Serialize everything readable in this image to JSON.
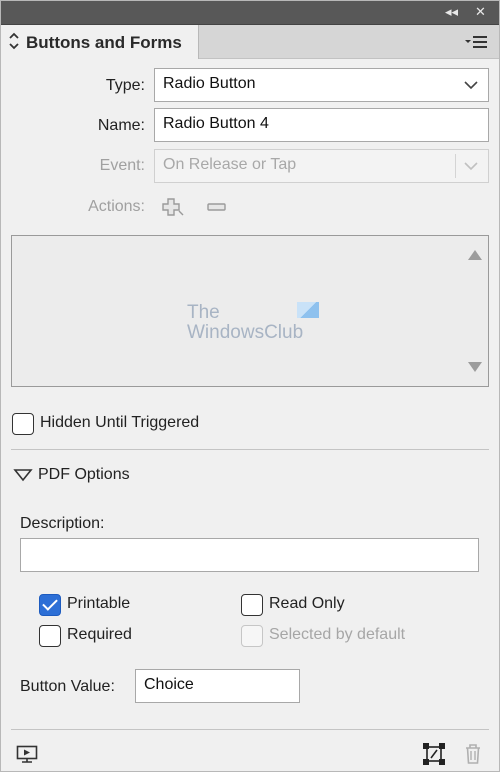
{
  "panel": {
    "title": "Buttons and Forms",
    "collapse_glyph": "◂◂",
    "close_glyph": "✕"
  },
  "form": {
    "type_label": "Type:",
    "type_value": "Radio Button",
    "name_label": "Name:",
    "name_value": "Radio Button 4",
    "event_label": "Event:",
    "event_value": "On Release or Tap",
    "actions_label": "Actions:"
  },
  "watermark": {
    "line1": "The",
    "line2": "WindowsClub"
  },
  "hidden_until_triggered": {
    "label": "Hidden Until Triggered",
    "checked": false
  },
  "pdf_options": {
    "header": "PDF Options",
    "description_label": "Description:",
    "description_value": "",
    "printable": {
      "label": "Printable",
      "checked": true
    },
    "read_only": {
      "label": "Read Only",
      "checked": false
    },
    "required": {
      "label": "Required",
      "checked": false
    },
    "selected_by_default": {
      "label": "Selected by default",
      "checked": false,
      "disabled": true
    },
    "button_value_label": "Button Value:",
    "button_value": "Choice"
  },
  "colors": {
    "checked_blue": "#2d6fd6",
    "top_bar": "#585858",
    "panel_bg": "#f0f0f0"
  },
  "icons": {
    "collapse": "double-chevron-left-icon",
    "close": "close-icon",
    "panel_menu": "panel-menu-icon",
    "add_action": "add-action-icon",
    "remove_action": "remove-action-icon",
    "preview": "preview-spread-icon",
    "convert": "convert-object-icon",
    "trash": "trash-icon"
  }
}
